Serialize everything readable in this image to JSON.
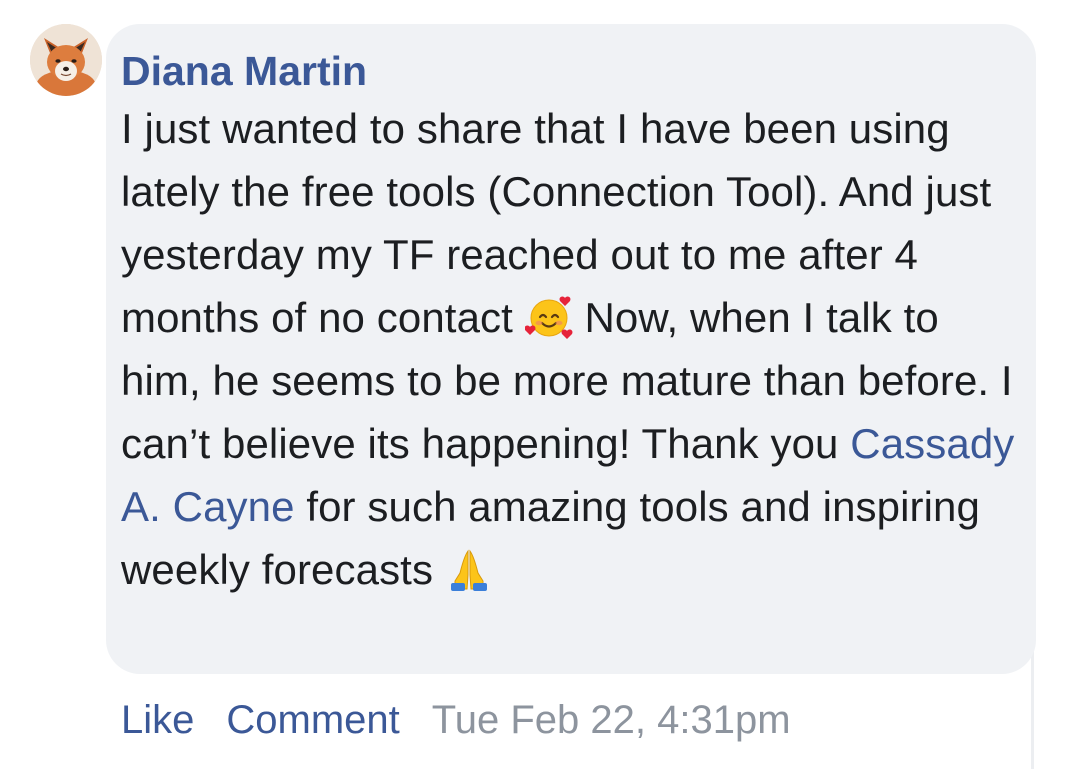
{
  "comment": {
    "author": "Diana Martin",
    "avatar_icon": "fox-avatar",
    "text_part1": "I just wanted to share that I have been using lately the free tools (Connection Tool). And just yesterday my TF reached out to me after 4 months of no contact ",
    "emoji_1": "smiling-face-with-hearts-emoji",
    "text_part2": " Now, when I talk to him, he seems to be more mature than before. I can’t believe its happening! Thank you ",
    "mention": "Cassady A. Cayne",
    "text_part3": " for such amazing tools and inspiring weekly forecasts ",
    "emoji_2": "folded-hands-emoji"
  },
  "actions": {
    "like_label": "Like",
    "comment_label": "Comment",
    "timestamp": "Tue Feb 22, 4:31pm"
  },
  "colors": {
    "link": "#3b5897",
    "bubble": "#f0f2f5",
    "text": "#1c1e21",
    "meta": "#8d949e"
  }
}
